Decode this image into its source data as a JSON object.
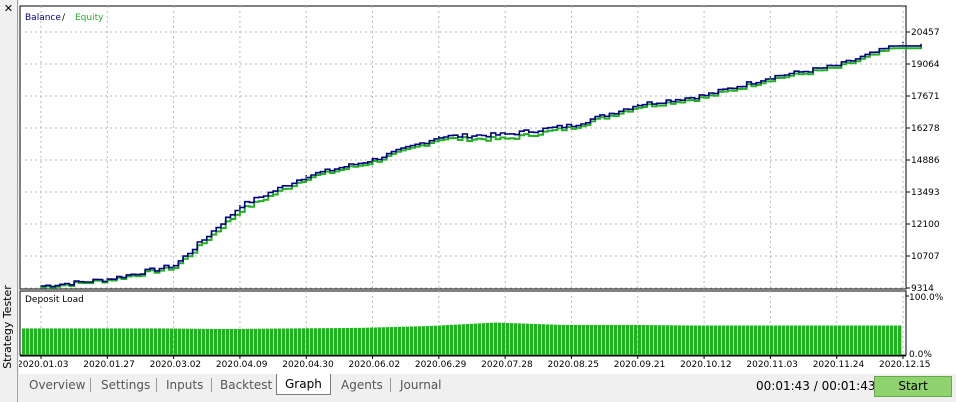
{
  "window": {
    "side_title": "Strategy Tester",
    "close_icon": "close-icon"
  },
  "main_chart": {
    "legend": {
      "balance_label": "Balance",
      "separator": " / ",
      "equity_label": "Equity",
      "balance_color": "#000080",
      "equity_color": "#22b022"
    },
    "y_ticks": [
      "20457",
      "19064",
      "17671",
      "16278",
      "14886",
      "13493",
      "12100",
      "10707",
      "9314"
    ]
  },
  "deposit_chart": {
    "title": "Deposit Load",
    "y_ticks": [
      "100.0%",
      "0.0%"
    ],
    "bar_color": "#22b022"
  },
  "x_ticks": [
    "2020.01.03",
    "2020.01.27",
    "2020.03.02",
    "2020.04.09",
    "2020.04.30",
    "2020.06.02",
    "2020.06.29",
    "2020.07.28",
    "2020.08.25",
    "2020.09.21",
    "2020.10.12",
    "2020.11.03",
    "2020.11.24",
    "2020.12.15"
  ],
  "chart_data": [
    {
      "type": "line",
      "title": "",
      "x": [
        "2020.01.03",
        "2020.01.27",
        "2020.03.02",
        "2020.04.09",
        "2020.04.30",
        "2020.06.02",
        "2020.06.29",
        "2020.07.28",
        "2020.08.25",
        "2020.09.21",
        "2020.10.12",
        "2020.11.03",
        "2020.11.24",
        "2020.12.15"
      ],
      "series": [
        {
          "name": "Balance",
          "values": [
            9400,
            9700,
            10300,
            12900,
            14200,
            14900,
            15900,
            16000,
            16400,
            17300,
            17700,
            18500,
            19000,
            20000
          ]
        },
        {
          "name": "Equity",
          "values": [
            9350,
            9650,
            10200,
            12700,
            14100,
            14800,
            15800,
            15800,
            16300,
            17200,
            17600,
            18400,
            18900,
            19900
          ]
        }
      ],
      "ylim": [
        9314,
        20457
      ],
      "grid": true,
      "legend": "top-left"
    },
    {
      "type": "bar",
      "title": "Deposit Load",
      "x": [
        "2020.01.03",
        "2020.01.27",
        "2020.03.02",
        "2020.04.09",
        "2020.04.30",
        "2020.06.02",
        "2020.06.29",
        "2020.07.28",
        "2020.08.25",
        "2020.09.21",
        "2020.10.12",
        "2020.11.03",
        "2020.11.24",
        "2020.12.15"
      ],
      "values": [
        45,
        45,
        45,
        44,
        45,
        46,
        49,
        55,
        51,
        51,
        50,
        50,
        50,
        50
      ],
      "ylim": [
        0,
        100
      ],
      "unit": "%"
    }
  ],
  "tabs": [
    {
      "label": "Overview",
      "active": false
    },
    {
      "label": "Settings",
      "active": false
    },
    {
      "label": "Inputs",
      "active": false
    },
    {
      "label": "Backtest",
      "active": false
    },
    {
      "label": "Graph",
      "active": true
    },
    {
      "label": "Agents",
      "active": false
    },
    {
      "label": "Journal",
      "active": false
    }
  ],
  "timer": "00:01:43 / 00:01:43",
  "start_button": "Start"
}
